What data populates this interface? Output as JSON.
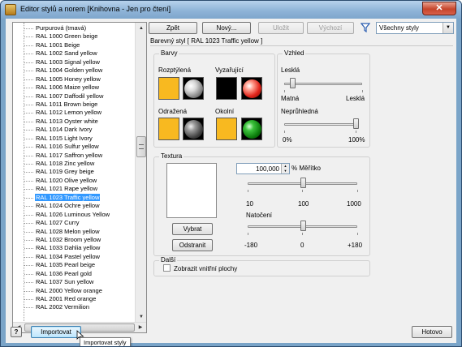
{
  "window": {
    "title": "Editor stylů a norem [Knihovna - Jen pro čtení]",
    "close_label": "✕"
  },
  "toolbar": {
    "back_label": "Zpět",
    "new_label": "Nový...",
    "save_label": "Uložit",
    "default_label": "Výchozí",
    "filter_value": "Všechny styly"
  },
  "list": {
    "items": [
      "Purpurová (tmavá)",
      "RAL 1000 Green beige",
      "RAL 1001 Beige",
      "RAL 1002 Sand yellow",
      "RAL 1003 Signal yellow",
      "RAL 1004 Golden yellow",
      "RAL 1005 Honey yellow",
      "RAL 1006 Maize yellow",
      "RAL 1007 Daffodil yellow",
      "RAL 1011 Brown beige",
      "RAL 1012 Lemon yellow",
      "RAL 1013 Oyster white",
      "RAL 1014 Dark Ivory",
      "RAL 1015 Light Ivory",
      "RAL 1016 Sulfur yellow",
      "RAL 1017 Saffron yellow",
      "RAL 1018 Zinc yellow",
      "RAL 1019 Grey beige",
      "RAL 1020 Olive yellow",
      "RAL 1021 Rape yellow",
      "RAL 1023 Traffic yellow",
      "RAL 1024 Ochre yellow",
      "RAL 1026 Luminous Yellow",
      "RAL 1027 Curry",
      "RAL 1028 Melon yellow",
      "RAL 1032 Broom yellow",
      "RAL 1033 Dahlia yellow",
      "RAL 1034 Pastel yellow",
      "RAL 1035 Pearl beige",
      "RAL 1036 Pearl gold",
      "RAL 1037 Sun yellow",
      "RAL 2000 Yellow orange",
      "RAL 2001 Red orange",
      "RAL 2002 Vermilion"
    ],
    "selected": "RAL 1023 Traffic yellow"
  },
  "style": {
    "header": "Barevný styl [ RAL 1023 Traffic yellow ]"
  },
  "colors": {
    "title": "Barvy",
    "diffuse_label": "Rozptýlená",
    "emissive_label": "Vyzařující",
    "specular_label": "Odražená",
    "ambient_label": "Okolní",
    "diffuse_color": "#f8b920",
    "emissive_color": "#000000",
    "specular_color": "#f8b920",
    "ambient_color": "#f8b920"
  },
  "appearance": {
    "title": "Vzhled",
    "shiny_label": "Lesklá",
    "matte_label": "Matná",
    "glossy_label": "Lesklá",
    "opacity_label": "Neprůhledná",
    "opacity_min": "0%",
    "opacity_max": "100%",
    "shininess_value": 0.1,
    "opacity_value": 1.0
  },
  "texture": {
    "title": "Textura",
    "scale_value": "100,000",
    "scale_label": "% Měřítko",
    "scale_ticks": [
      "10",
      "100",
      "1000"
    ],
    "rotation_label": "Natočení",
    "rotation_ticks": [
      "-180",
      "0",
      "+180"
    ],
    "select_label": "Vybrat",
    "remove_label": "Odstranit"
  },
  "other": {
    "title": "Další",
    "show_interior_label": "Zobrazit vnitřní plochy"
  },
  "footer": {
    "help_label": "?",
    "import_label": "Importovat",
    "import_tooltip": "Importovat styly",
    "done_label": "Hotovo"
  }
}
